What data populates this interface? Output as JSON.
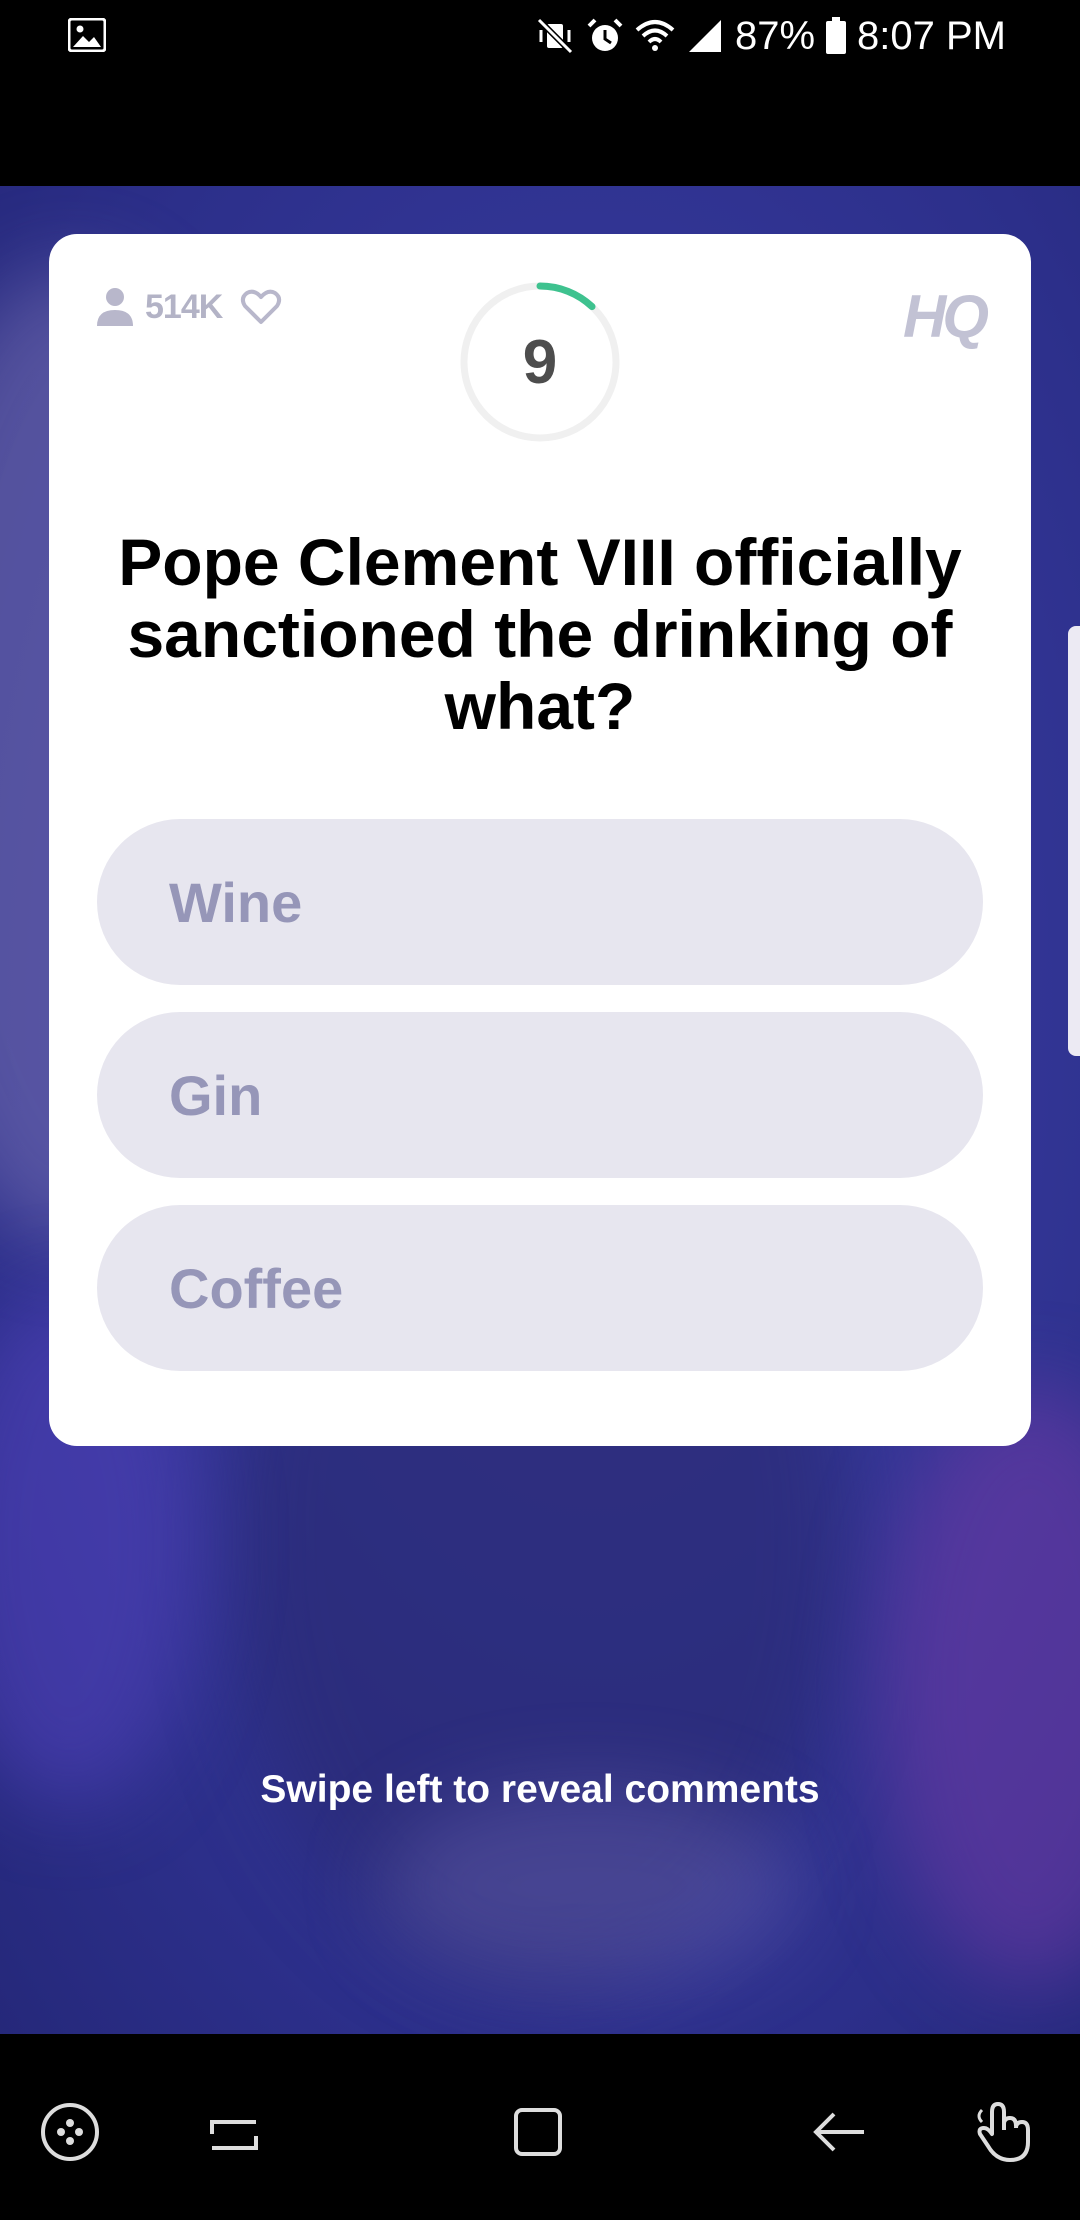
{
  "status_bar": {
    "battery": "87%",
    "time": "8:07 PM",
    "icons": [
      "gallery-icon",
      "mute-vibrate-icon",
      "alarm-icon",
      "wifi-icon",
      "signal-icon",
      "battery-icon"
    ]
  },
  "card": {
    "viewer_count": "514K",
    "timer": "9",
    "timer_remaining_fraction": 0.12,
    "logo": "HQ",
    "question": "Pope Clement VIII officially sanctioned the drinking of what?",
    "answers": [
      {
        "label": "Wine"
      },
      {
        "label": "Gin"
      },
      {
        "label": "Coffee"
      }
    ]
  },
  "hint": "Swipe left to reveal comments",
  "colors": {
    "timer_accent": "#3ec28f",
    "answer_bg": "#e7e6ef",
    "answer_text": "#9696b8",
    "video_bg": "#35389a"
  },
  "nav_bar": {
    "icons": [
      "game-tools-icon",
      "recent-apps-icon",
      "home-icon",
      "back-icon",
      "assistant-hand-icon"
    ]
  }
}
